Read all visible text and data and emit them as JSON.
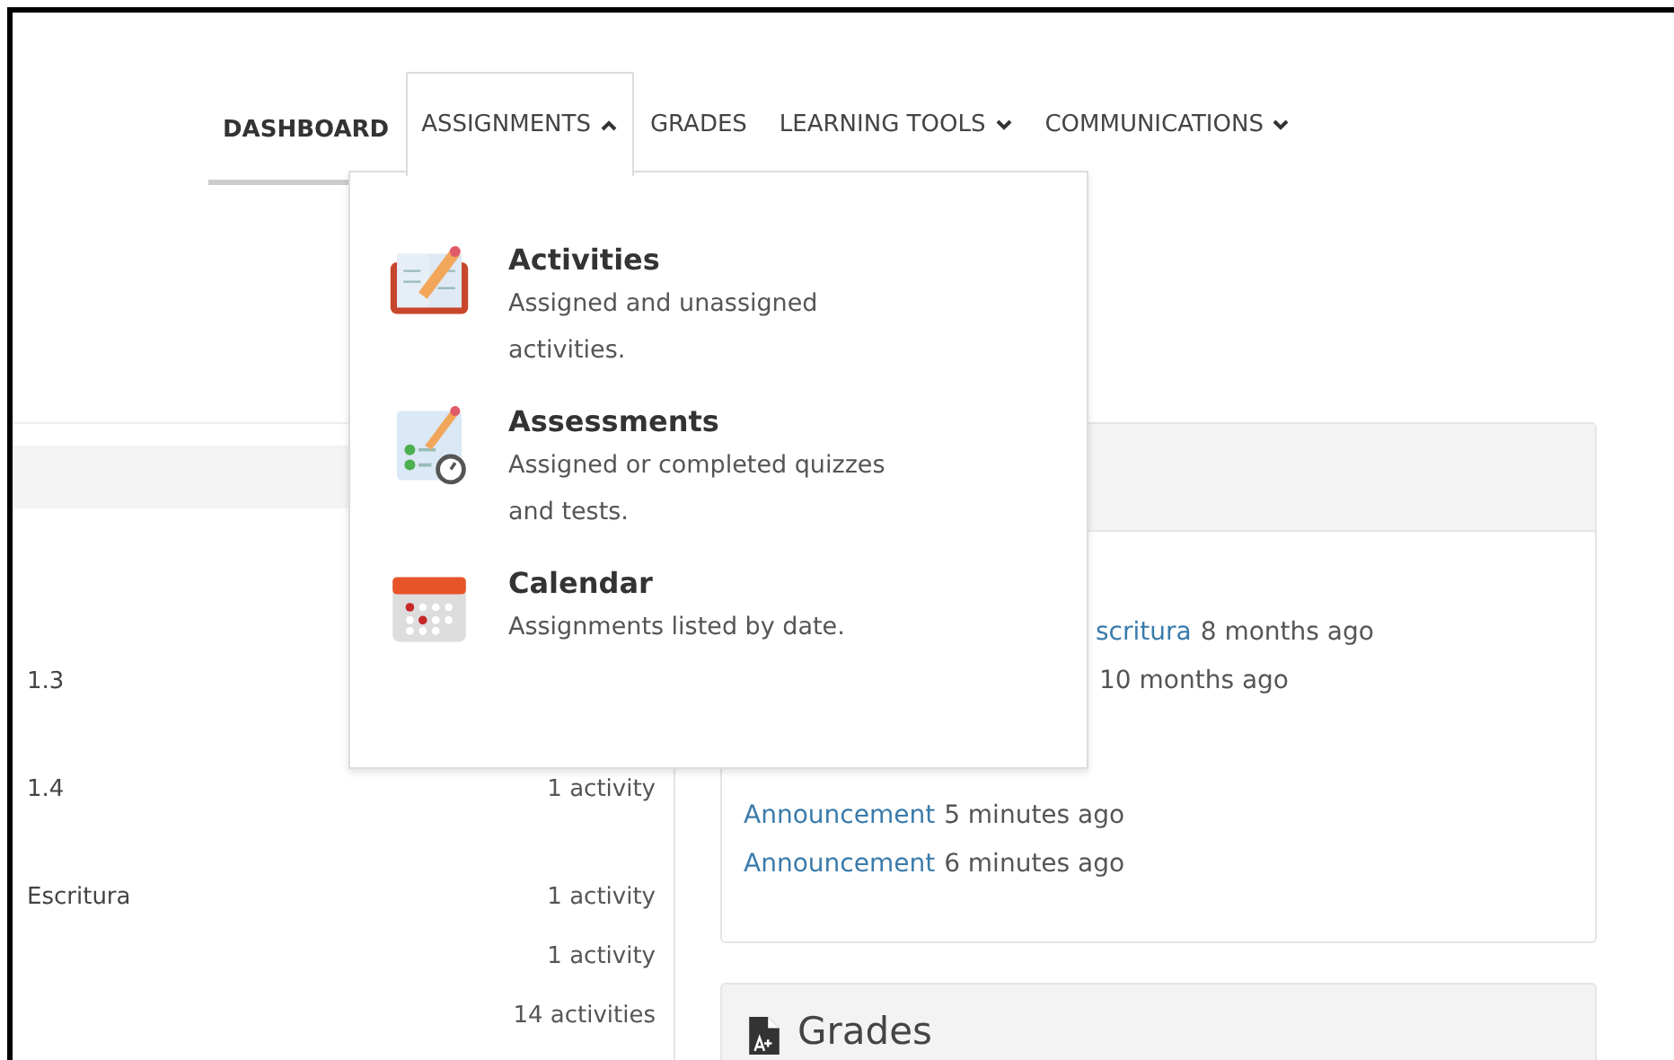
{
  "nav": [
    {
      "label": "DASHBOARD",
      "kind": "link",
      "selected": true,
      "expanded": false
    },
    {
      "label": "ASSIGNMENTS",
      "kind": "dropdown",
      "selected": false,
      "expanded": true
    },
    {
      "label": "GRADES",
      "kind": "link",
      "selected": false,
      "expanded": false
    },
    {
      "label": "LEARNING TOOLS",
      "kind": "dropdown",
      "selected": false,
      "expanded": false
    },
    {
      "label": "COMMUNICATIONS",
      "kind": "dropdown",
      "selected": false,
      "expanded": false
    }
  ],
  "menu": [
    {
      "title": "Activities",
      "description": "Assigned and unassigned activities.",
      "kind": "activities"
    },
    {
      "title": "Assessments",
      "description": "Assigned or completed quizzes and tests.",
      "kind": "assessments"
    },
    {
      "title": "Calendar",
      "description": "Assignments listed by date.",
      "kind": "calendar"
    }
  ],
  "units": [
    {
      "label": "1.3"
    },
    {
      "label": "1.4",
      "count": "1 activity"
    },
    {
      "label": "Escritura",
      "count": "1 activity"
    },
    {
      "count": "1 activity"
    },
    {
      "count": "14 activities"
    }
  ],
  "activity": [
    {
      "link": "scritura",
      "time": "8 months ago"
    },
    {
      "time": "10 months ago"
    }
  ],
  "announcements": [
    {
      "link": "Announcement",
      "time": "5 minutes ago"
    },
    {
      "link": "Announcement",
      "time": "6 minutes ago"
    }
  ],
  "grades_card": {
    "title": "Grades"
  }
}
